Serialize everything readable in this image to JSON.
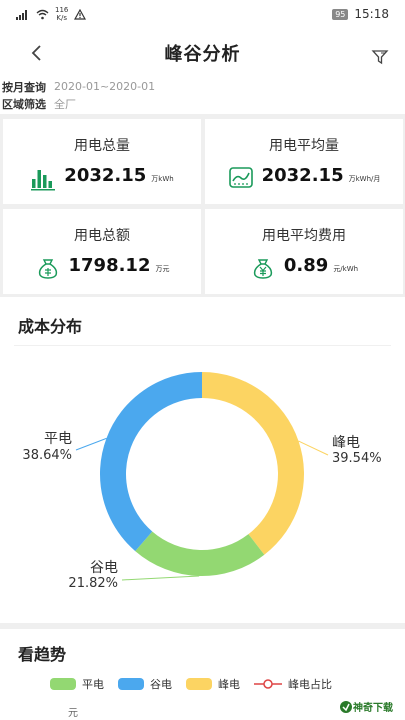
{
  "status_bar": {
    "speed_value": "116",
    "speed_unit": "K/s",
    "battery": "95",
    "time": "15:18"
  },
  "header": {
    "title": "峰谷分析"
  },
  "query": {
    "month_label": "按月查询",
    "month_value": "2020-01~2020-01",
    "region_label": "区域筛选",
    "region_value": "全厂"
  },
  "cards": {
    "total_power": {
      "title": "用电总量",
      "value": "2032.15",
      "unit": "万kWh",
      "icon": "bar-chart-icon"
    },
    "avg_power": {
      "title": "用电平均量",
      "value": "2032.15",
      "unit": "万kWh/月",
      "icon": "trend-chart-icon"
    },
    "total_cost": {
      "title": "用电总额",
      "value": "1798.12",
      "unit": "万元",
      "icon": "money-bag-icon"
    },
    "avg_cost": {
      "title": "用电平均费用",
      "value": "0.89",
      "unit": "元/kWh",
      "icon": "yuan-bag-icon"
    }
  },
  "colors": {
    "accent": "#1a9a5a",
    "ping": "#4ba8ee",
    "gu": "#93d872",
    "feng": "#fcd462"
  },
  "cost_section": {
    "title": "成本分布"
  },
  "chart_data": {
    "type": "pie",
    "categories": [
      "峰电",
      "谷电",
      "平电"
    ],
    "values": [
      39.54,
      21.82,
      38.64
    ],
    "value_labels": [
      "39.54%",
      "21.82%",
      "38.64%"
    ],
    "colors": [
      "#fcd462",
      "#93d872",
      "#4ba8ee"
    ]
  },
  "trend_section": {
    "title": "看趋势",
    "legend": [
      "平电",
      "谷电",
      "峰电",
      "峰电占比"
    ],
    "y_unit": "元"
  },
  "brand": {
    "text": "神奇下载"
  }
}
